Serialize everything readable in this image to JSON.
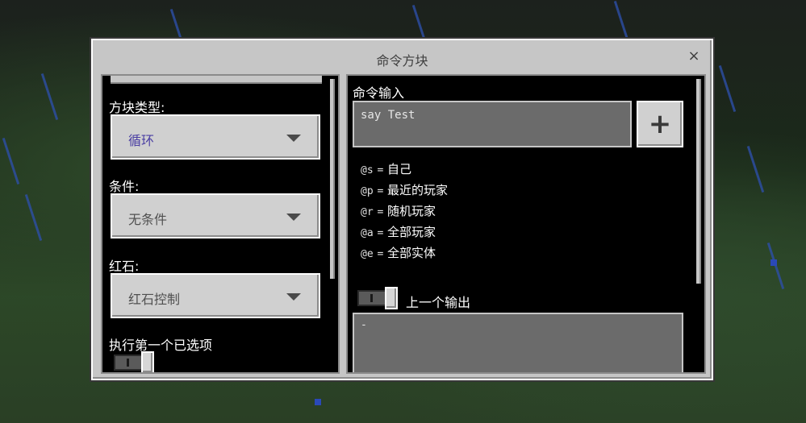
{
  "window": {
    "title": "命令方块",
    "close_glyph": "×"
  },
  "left": {
    "block_type": {
      "label": "方块类型:",
      "value": "循环"
    },
    "condition": {
      "label": "条件:",
      "value": "无条件"
    },
    "redstone": {
      "label": "红石:",
      "value": "红石控制"
    },
    "execute_first": {
      "label": "执行第一个已选项"
    }
  },
  "right": {
    "command_label": "命令输入",
    "command_value": "say Test",
    "plus_label": "+",
    "selectors": [
      {
        "code": "@s",
        "eq": "=",
        "desc": "自己"
      },
      {
        "code": "@p",
        "eq": "=",
        "desc": "最近的玩家"
      },
      {
        "code": "@r",
        "eq": "=",
        "desc": "随机玩家"
      },
      {
        "code": "@a",
        "eq": "=",
        "desc": "全部玩家"
      },
      {
        "code": "@e",
        "eq": "=",
        "desc": "全部实体"
      }
    ],
    "previous_output_label": "上一个输出",
    "output_value": "-"
  },
  "colors": {
    "dropdown_value_accent": "#4b3fa3",
    "rain": "#2d4fa8",
    "dialog_bg": "#c6c6c6"
  }
}
